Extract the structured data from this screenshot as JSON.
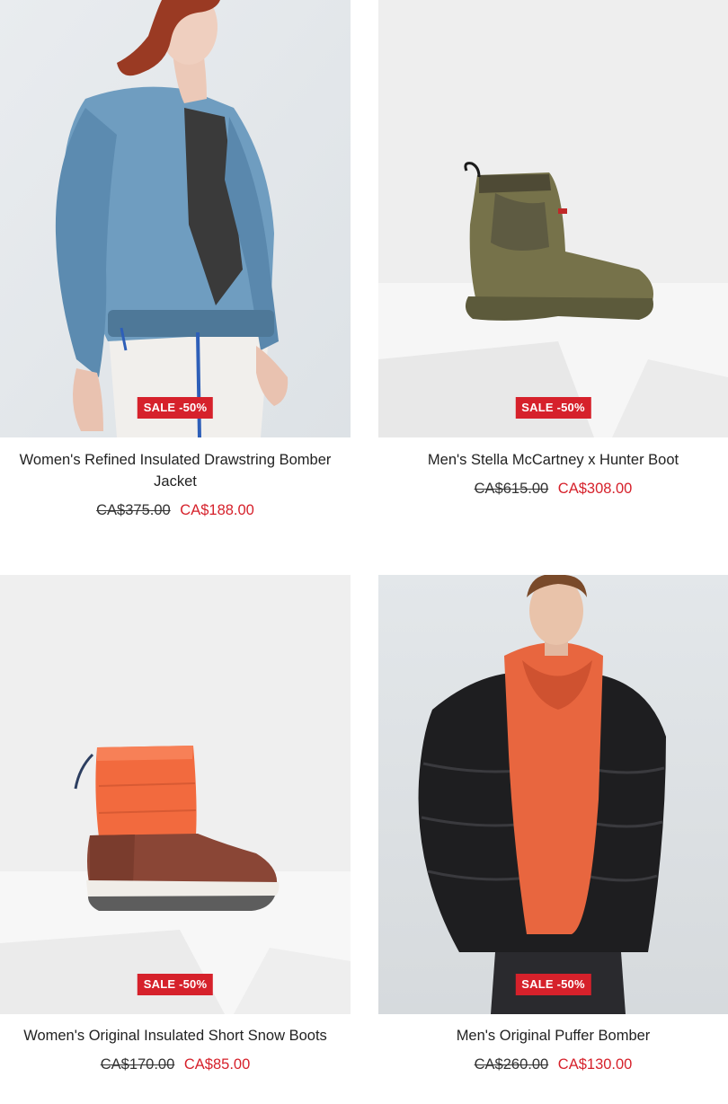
{
  "products": [
    {
      "badge": "SALE -50%",
      "title": "Women's Refined Insulated Drawstring Bomber Jacket",
      "price_original": "CA$375.00",
      "price_sale": "CA$188.00"
    },
    {
      "badge": "SALE -50%",
      "title": "Men's Stella McCartney x Hunter Boot",
      "price_original": "CA$615.00",
      "price_sale": "CA$308.00"
    },
    {
      "badge": "SALE -50%",
      "title": "Women's Original Insulated Short Snow Boots",
      "price_original": "CA$170.00",
      "price_sale": "CA$85.00"
    },
    {
      "badge": "SALE -50%",
      "title": "Men's Original Puffer Bomber",
      "price_original": "CA$260.00",
      "price_sale": "CA$130.00"
    }
  ],
  "colors": {
    "sale_red": "#d6212b",
    "text": "#222222",
    "image_bg": "#eeeeee"
  }
}
